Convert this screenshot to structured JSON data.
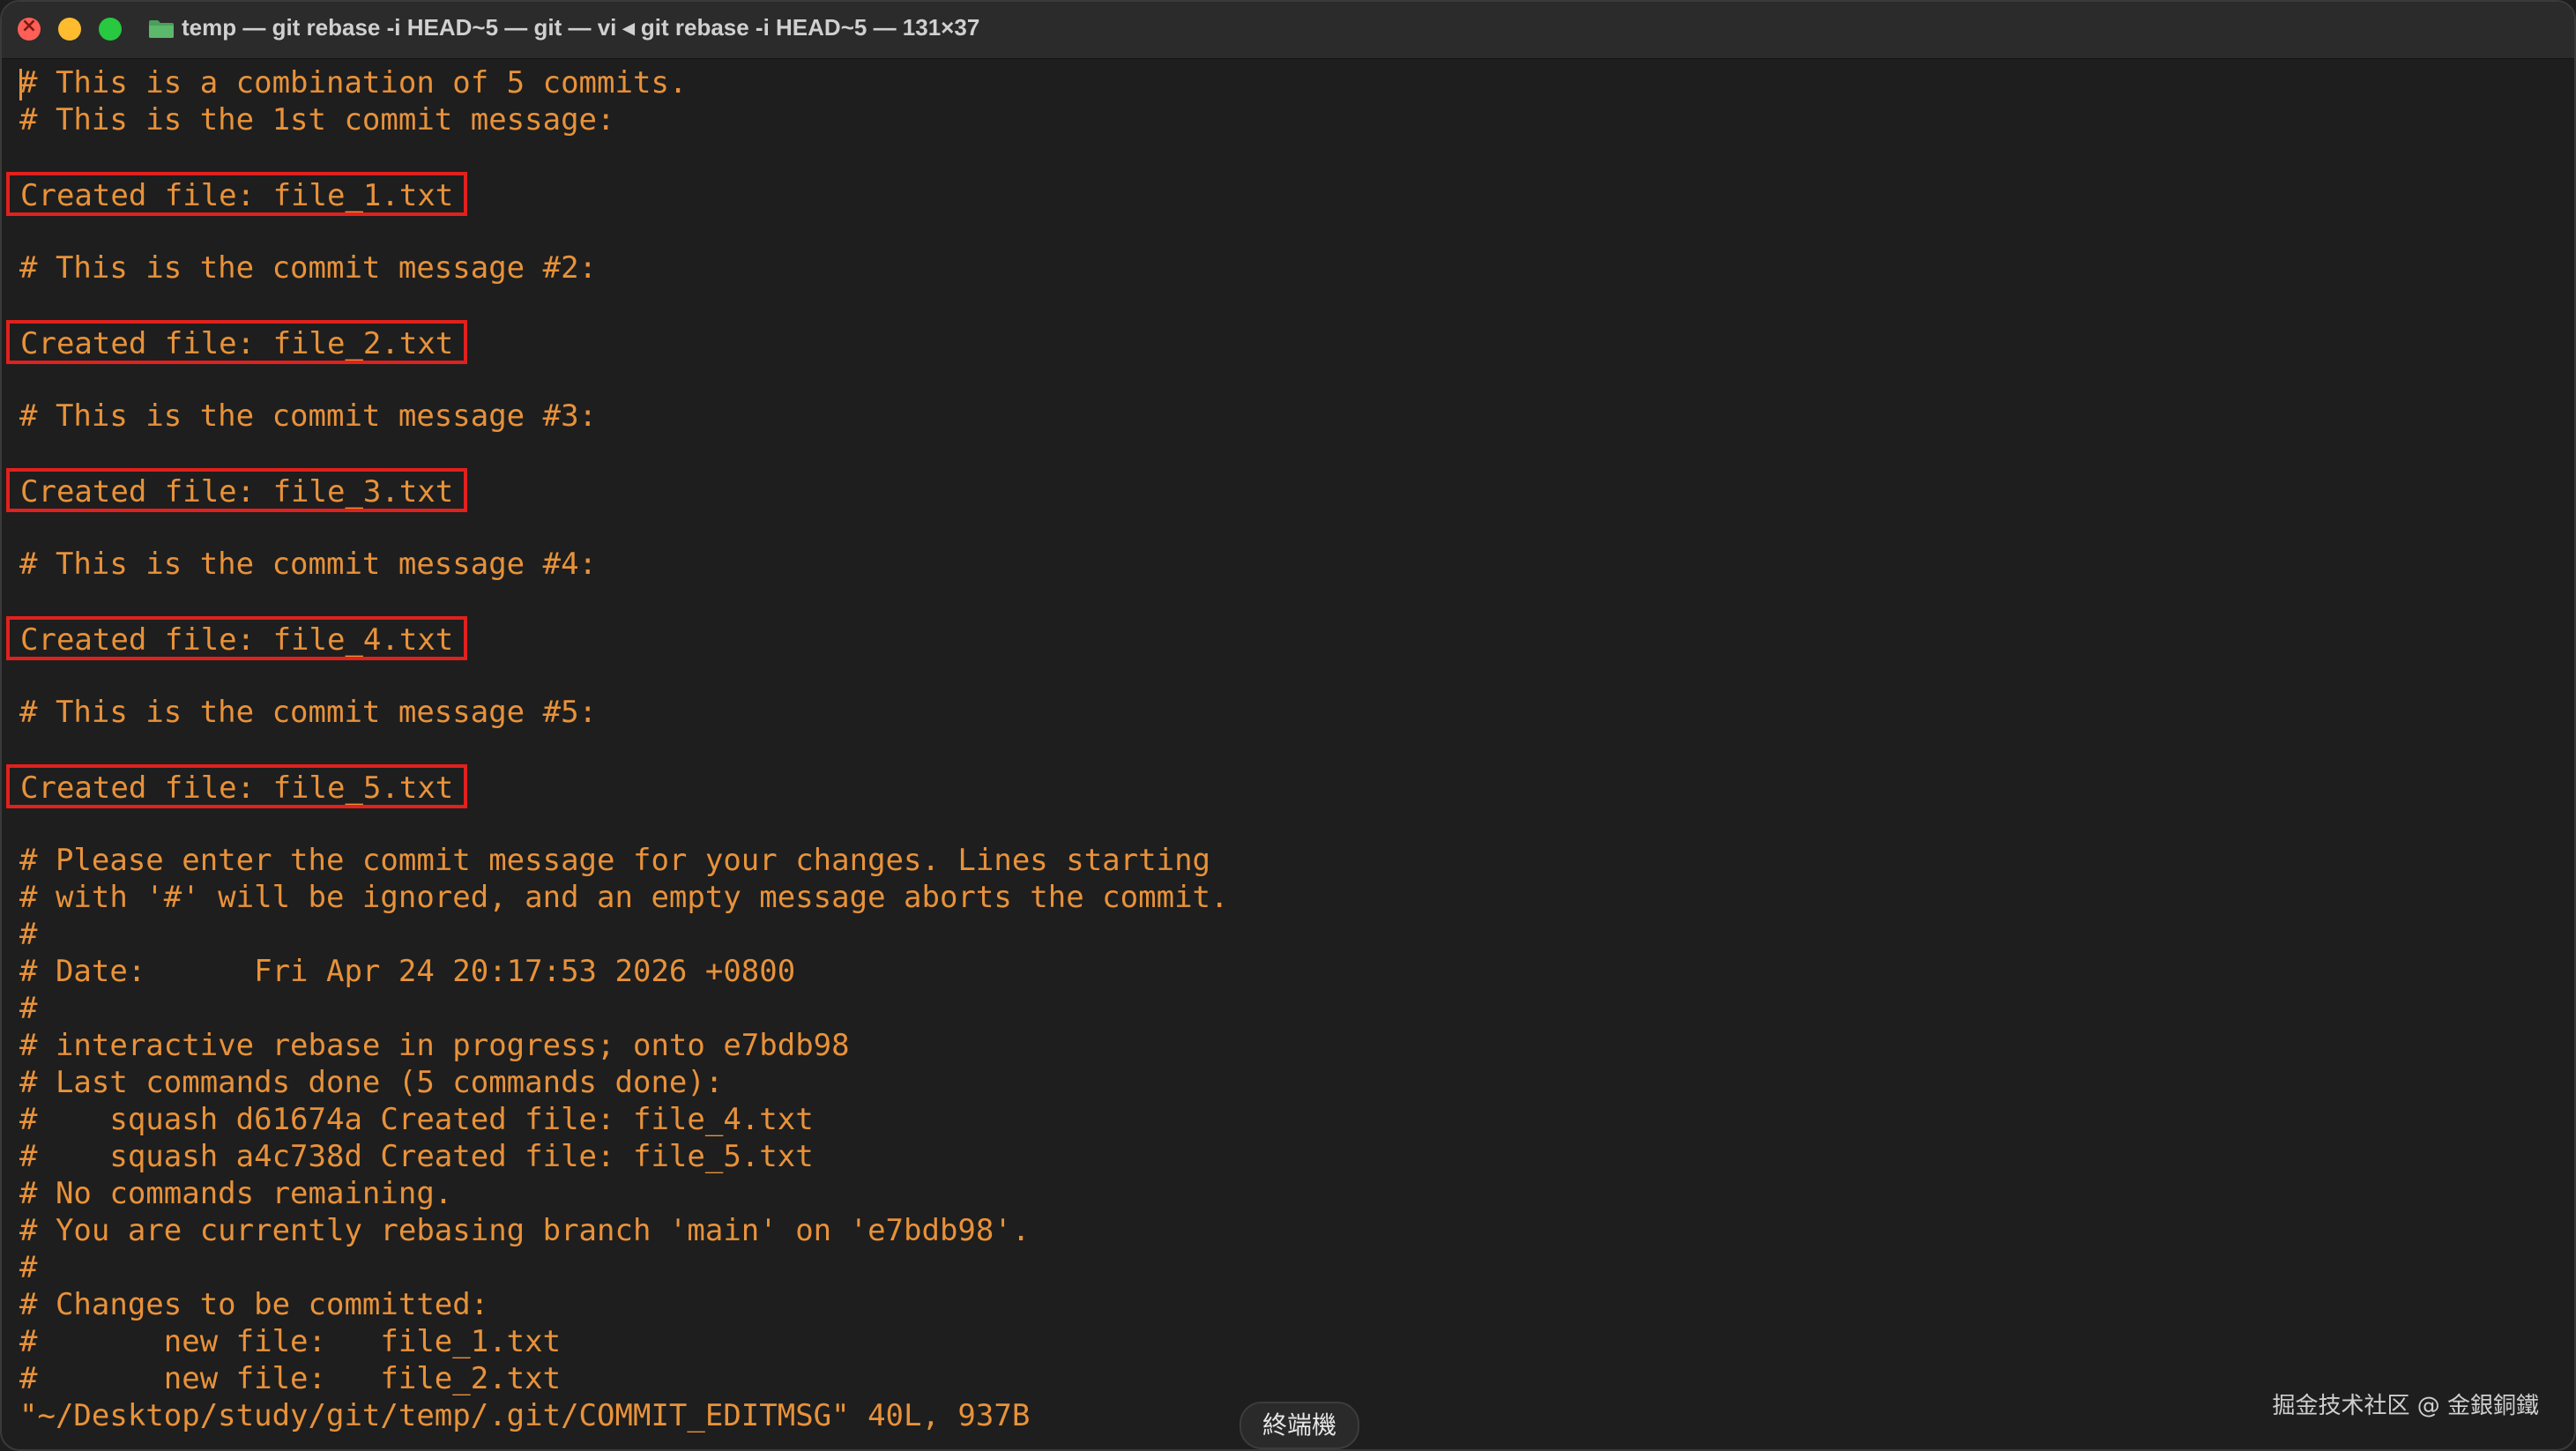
{
  "window": {
    "title": "temp — git rebase -i HEAD~5 — git — vi ◂ git rebase -i HEAD~5 — 131×37"
  },
  "colors": {
    "terminal_text": "#e8923a",
    "highlight_box": "#e0211d",
    "background": "#1e1e1e"
  },
  "icons": {
    "title_icon": "folder-icon"
  },
  "lines": [
    {
      "text": "# This is a combination of 5 commits.",
      "boxed": false
    },
    {
      "text": "# This is the 1st commit message:",
      "boxed": false
    },
    {
      "text": "",
      "boxed": false
    },
    {
      "text": "Created file: file_1.txt",
      "boxed": true
    },
    {
      "text": "",
      "boxed": false
    },
    {
      "text": "# This is the commit message #2:",
      "boxed": false
    },
    {
      "text": "",
      "boxed": false
    },
    {
      "text": "Created file: file_2.txt",
      "boxed": true
    },
    {
      "text": "",
      "boxed": false
    },
    {
      "text": "# This is the commit message #3:",
      "boxed": false
    },
    {
      "text": "",
      "boxed": false
    },
    {
      "text": "Created file: file_3.txt",
      "boxed": true
    },
    {
      "text": "",
      "boxed": false
    },
    {
      "text": "# This is the commit message #4:",
      "boxed": false
    },
    {
      "text": "",
      "boxed": false
    },
    {
      "text": "Created file: file_4.txt",
      "boxed": true
    },
    {
      "text": "",
      "boxed": false
    },
    {
      "text": "# This is the commit message #5:",
      "boxed": false
    },
    {
      "text": "",
      "boxed": false
    },
    {
      "text": "Created file: file_5.txt",
      "boxed": true
    },
    {
      "text": "",
      "boxed": false
    },
    {
      "text": "# Please enter the commit message for your changes. Lines starting",
      "boxed": false
    },
    {
      "text": "# with '#' will be ignored, and an empty message aborts the commit.",
      "boxed": false
    },
    {
      "text": "#",
      "boxed": false
    },
    {
      "text": "# Date:      Fri Apr 24 20:17:53 2026 +0800",
      "boxed": false
    },
    {
      "text": "#",
      "boxed": false
    },
    {
      "text": "# interactive rebase in progress; onto e7bdb98",
      "boxed": false
    },
    {
      "text": "# Last commands done (5 commands done):",
      "boxed": false
    },
    {
      "text": "#    squash d61674a Created file: file_4.txt",
      "boxed": false
    },
    {
      "text": "#    squash a4c738d Created file: file_5.txt",
      "boxed": false
    },
    {
      "text": "# No commands remaining.",
      "boxed": false
    },
    {
      "text": "# You are currently rebasing branch 'main' on 'e7bdb98'.",
      "boxed": false
    },
    {
      "text": "#",
      "boxed": false
    },
    {
      "text": "# Changes to be committed:",
      "boxed": false
    },
    {
      "text": "#       new file:   file_1.txt",
      "boxed": false
    },
    {
      "text": "#       new file:   file_2.txt",
      "boxed": false
    },
    {
      "text": "\"~/Desktop/study/git/temp/.git/COMMIT_EDITMSG\" 40L, 937B",
      "boxed": false
    }
  ],
  "tooltip": "終端機",
  "watermark": "掘金技术社区 @ 金銀銅鐵"
}
